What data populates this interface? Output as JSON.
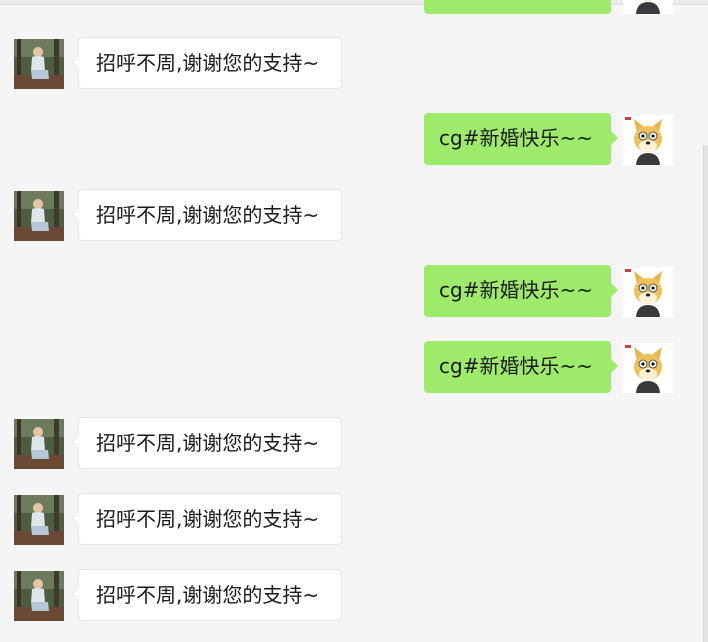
{
  "colors": {
    "background": "#f5f5f5",
    "incoming_bubble": "#ffffff",
    "outgoing_bubble": "#9eea6a"
  },
  "messages": [
    {
      "direction": "outgoing",
      "avatar": "doge-cartoon-avatar",
      "text": ""
    },
    {
      "direction": "incoming",
      "avatar": "person-forest-photo-avatar",
      "text": "招呼不周,谢谢您的支持~"
    },
    {
      "direction": "outgoing",
      "avatar": "doge-cartoon-avatar",
      "text": "cg#新婚快乐~~"
    },
    {
      "direction": "incoming",
      "avatar": "person-forest-photo-avatar",
      "text": "招呼不周,谢谢您的支持~"
    },
    {
      "direction": "outgoing",
      "avatar": "doge-cartoon-avatar",
      "text": "cg#新婚快乐~~"
    },
    {
      "direction": "outgoing",
      "avatar": "doge-cartoon-avatar",
      "text": "cg#新婚快乐~~"
    },
    {
      "direction": "incoming",
      "avatar": "person-forest-photo-avatar",
      "text": "招呼不周,谢谢您的支持~"
    },
    {
      "direction": "incoming",
      "avatar": "person-forest-photo-avatar",
      "text": "招呼不周,谢谢您的支持~"
    },
    {
      "direction": "incoming",
      "avatar": "person-forest-photo-avatar",
      "text": "招呼不周,谢谢您的支持~"
    }
  ]
}
